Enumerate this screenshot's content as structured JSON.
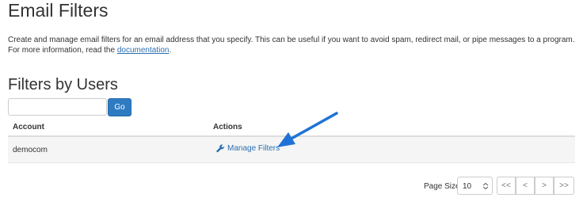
{
  "header": {
    "title": "Email Filters"
  },
  "description": {
    "line1": "Create and manage email filters for an email address that you specify. This can be useful if you want to avoid spam, redirect mail, or pipe messages to a program.",
    "line2_prefix": "For more information, read the ",
    "link_label": "documentation",
    "line2_suffix": "."
  },
  "section": {
    "title": "Filters by Users"
  },
  "search": {
    "value": "",
    "placeholder": "",
    "go_label": "Go"
  },
  "table": {
    "columns": [
      "Account",
      "Actions"
    ],
    "rows": [
      {
        "account": "democom",
        "action_label": "Manage Filters",
        "action_icon": "wrench-icon"
      }
    ]
  },
  "annotation": {
    "arrow_color": "#1f73d6"
  },
  "pagination": {
    "page_size_label": "Page Size",
    "page_size_value": "10",
    "first_label": "<<",
    "prev_label": "<",
    "next_label": ">",
    "last_label": ">>"
  },
  "colors": {
    "accent": "#2e7bc2",
    "link": "#2a6fb0",
    "row_background": "#f5f5f5"
  }
}
